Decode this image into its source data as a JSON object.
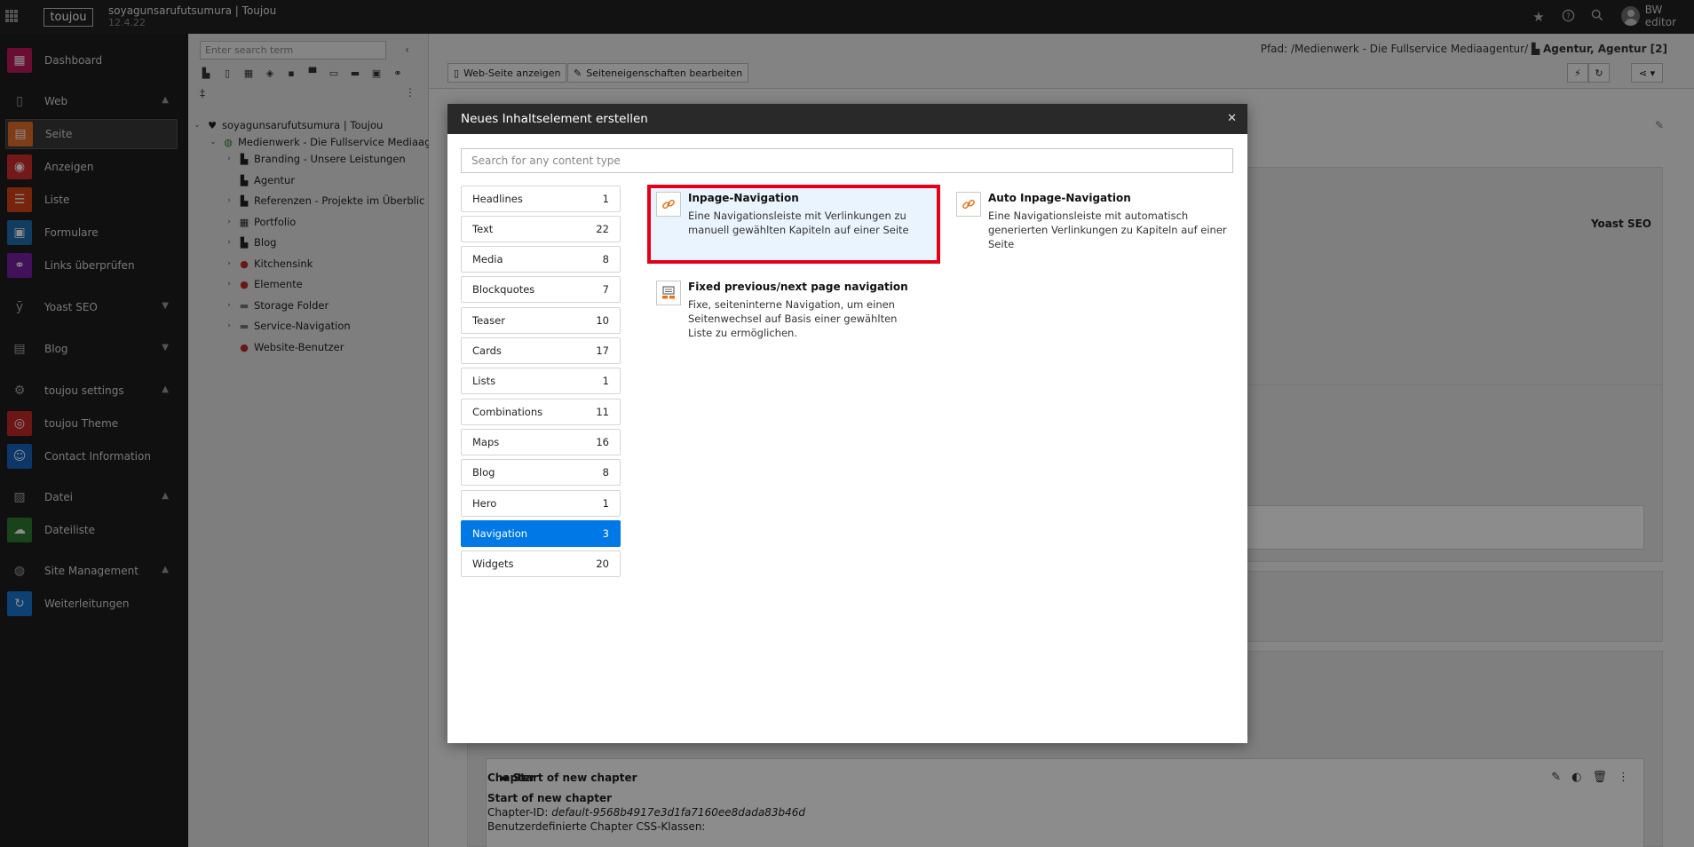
{
  "topbar": {
    "logo": "toujou",
    "site_name": "soyagunsarufutsumura | Toujou",
    "version": "12.4.22",
    "user_name": "BW editor",
    "icons": [
      "bookmark-star-icon",
      "help-icon",
      "search-icon"
    ]
  },
  "module_menu": {
    "dashboard": "Dashboard",
    "web": "Web",
    "seite": "Seite",
    "anzeigen": "Anzeigen",
    "liste": "Liste",
    "formulare": "Formulare",
    "links": "Links überprüfen",
    "yoast": "Yoast SEO",
    "blog": "Blog",
    "toujou_settings": "toujou settings",
    "toujou_theme": "toujou Theme",
    "contact_information": "Contact Information",
    "datei": "Datei",
    "dateiliste": "Dateiliste",
    "site_management": "Site Management",
    "weiterleitungen": "Weiterleitungen",
    "colors": {
      "dashboard": "#c2185b",
      "seite": "#e56f2b",
      "anzeigen": "#d32f2f",
      "liste": "#d84315",
      "formulare": "#1e6fb0",
      "links": "#7b1fa2",
      "toujou_theme": "#c62828",
      "contact_information": "#1565c0",
      "dateiliste": "#2e7d32",
      "weiterleitungen": "#1976d2"
    }
  },
  "page_tree": {
    "search_placeholder": "Enter search term",
    "nodes": [
      "soyagunsarufutsumura | Toujou",
      "Medienwerk - Die Fullservice Mediaag",
      "Branding - Unsere Leistungen",
      "Agentur",
      "Referenzen - Projekte im Überblic",
      "Portfolio",
      "Blog",
      "Kitchensink",
      "Elemente",
      "Storage Folder",
      "Service-Navigation",
      "Website-Benutzer"
    ]
  },
  "docheader": {
    "breadcrumb_prefix": "Pfad: /Medienwerk - Die Fullservice Mediaagentur/",
    "breadcrumb_current": "Agentur, Agentur [2]",
    "btn_view": "Web-Seite anzeigen",
    "btn_edit": "Seiteneigenschaften bearbeiten"
  },
  "background_content": {
    "yoast_label": "Yoast SEO",
    "element_title": "Start of new chapter",
    "chapter_label": "Chapter",
    "chapter_heading": "Start of new chapter",
    "chapter_id_label": "Chapter-ID:",
    "chapter_id_value": "default-9568b4917e3d1fa7160ee8dada83b46d",
    "css_classes_label": "Benutzerdefinierte Chapter CSS-Klassen:"
  },
  "modal": {
    "title": "Neues Inhaltselement erstellen",
    "search_placeholder": "Search for any content type",
    "categories": [
      {
        "label": "Headlines",
        "count": "1"
      },
      {
        "label": "Text",
        "count": "22"
      },
      {
        "label": "Media",
        "count": "8"
      },
      {
        "label": "Blockquotes",
        "count": "7"
      },
      {
        "label": "Teaser",
        "count": "10"
      },
      {
        "label": "Cards",
        "count": "17"
      },
      {
        "label": "Lists",
        "count": "1"
      },
      {
        "label": "Combinations",
        "count": "11"
      },
      {
        "label": "Maps",
        "count": "16"
      },
      {
        "label": "Blog",
        "count": "8"
      },
      {
        "label": "Hero",
        "count": "1"
      },
      {
        "label": "Navigation",
        "count": "3"
      },
      {
        "label": "Widgets",
        "count": "20"
      }
    ],
    "active_category": "Navigation",
    "content_types": [
      {
        "title": "Inpage-Navigation",
        "desc": "Eine Navigationsleiste mit Verlinkungen zu manuell gewählten Kapiteln auf einer Seite",
        "icon": "link-icon"
      },
      {
        "title": "Auto Inpage-Navigation",
        "desc": "Eine Navigationsleiste mit automatisch generierten Verlinkungen zu Kapiteln auf einer Seite",
        "icon": "link-icon"
      },
      {
        "title": "Fixed previous/next page navigation",
        "desc": "Fixe, seiteninterne Navigation, um einen Seitenwechsel auf Basis einer gewählten Liste zu ermöglichen.",
        "icon": "page-navigation-icon"
      }
    ],
    "highlight_color": "#e4001b",
    "accent_color": "#0078e6"
  }
}
